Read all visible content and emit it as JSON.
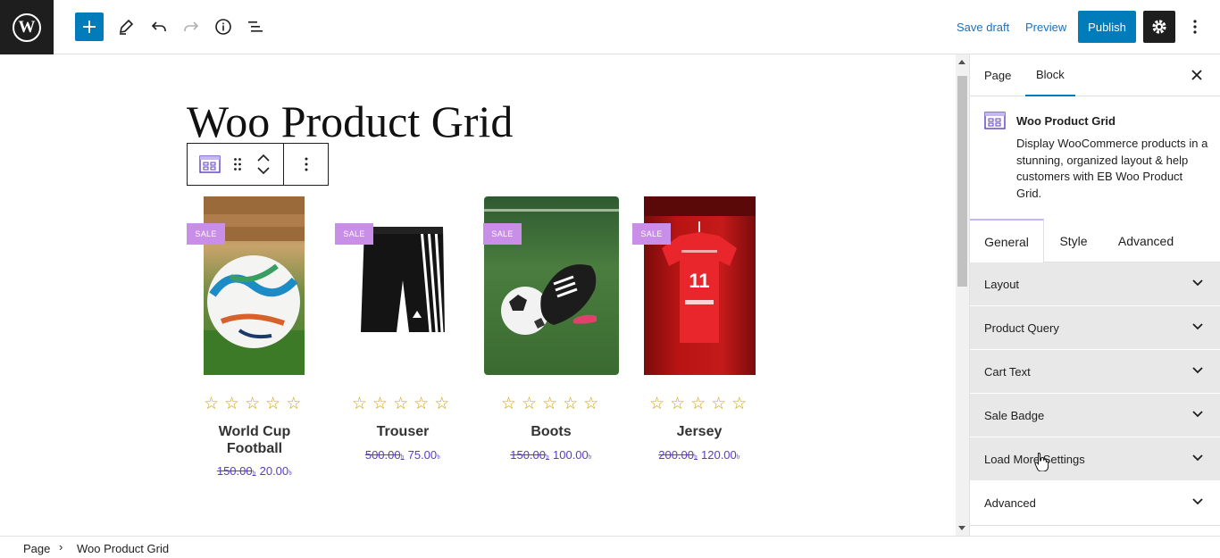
{
  "header": {
    "save_draft": "Save draft",
    "preview": "Preview",
    "publish": "Publish"
  },
  "canvas": {
    "title": "Woo Product Grid",
    "products": [
      {
        "name_line1": "World Cup",
        "name_line2": "Football",
        "old_price": "150.00",
        "new_price": "20.00",
        "currency": "৳",
        "badge": "SALE",
        "rating_stars": 0
      },
      {
        "name_line1": "Trouser",
        "name_line2": "",
        "old_price": "500.00",
        "new_price": "75.00",
        "currency": "৳",
        "badge": "SALE",
        "rating_stars": 0
      },
      {
        "name_line1": "Boots",
        "name_line2": "",
        "old_price": "150.00",
        "new_price": "100.00",
        "currency": "৳",
        "badge": "SALE",
        "rating_stars": 0
      },
      {
        "name_line1": "Jersey",
        "name_line2": "",
        "old_price": "200.00",
        "new_price": "120.00",
        "currency": "৳",
        "badge": "SALE",
        "rating_stars": 0
      }
    ]
  },
  "sidebar": {
    "tabs": [
      "Page",
      "Block"
    ],
    "active_tab": "Block",
    "block": {
      "title": "Woo Product Grid",
      "description": "Display WooCommerce products in a stunning, organized layout & help customers with EB Woo Product Grid."
    },
    "settings_tabs": [
      "General",
      "Style",
      "Advanced"
    ],
    "active_settings_tab": "General",
    "panels": [
      "Layout",
      "Product Query",
      "Cart Text",
      "Sale Badge",
      "Load More Settings",
      "Advanced"
    ]
  },
  "breadcrumb": [
    "Page",
    "Woo Product Grid"
  ],
  "colors": {
    "accent": "#007cba",
    "sale_badge": "#c88ee8",
    "price": "#5b3cc4",
    "star": "#d4a106"
  }
}
